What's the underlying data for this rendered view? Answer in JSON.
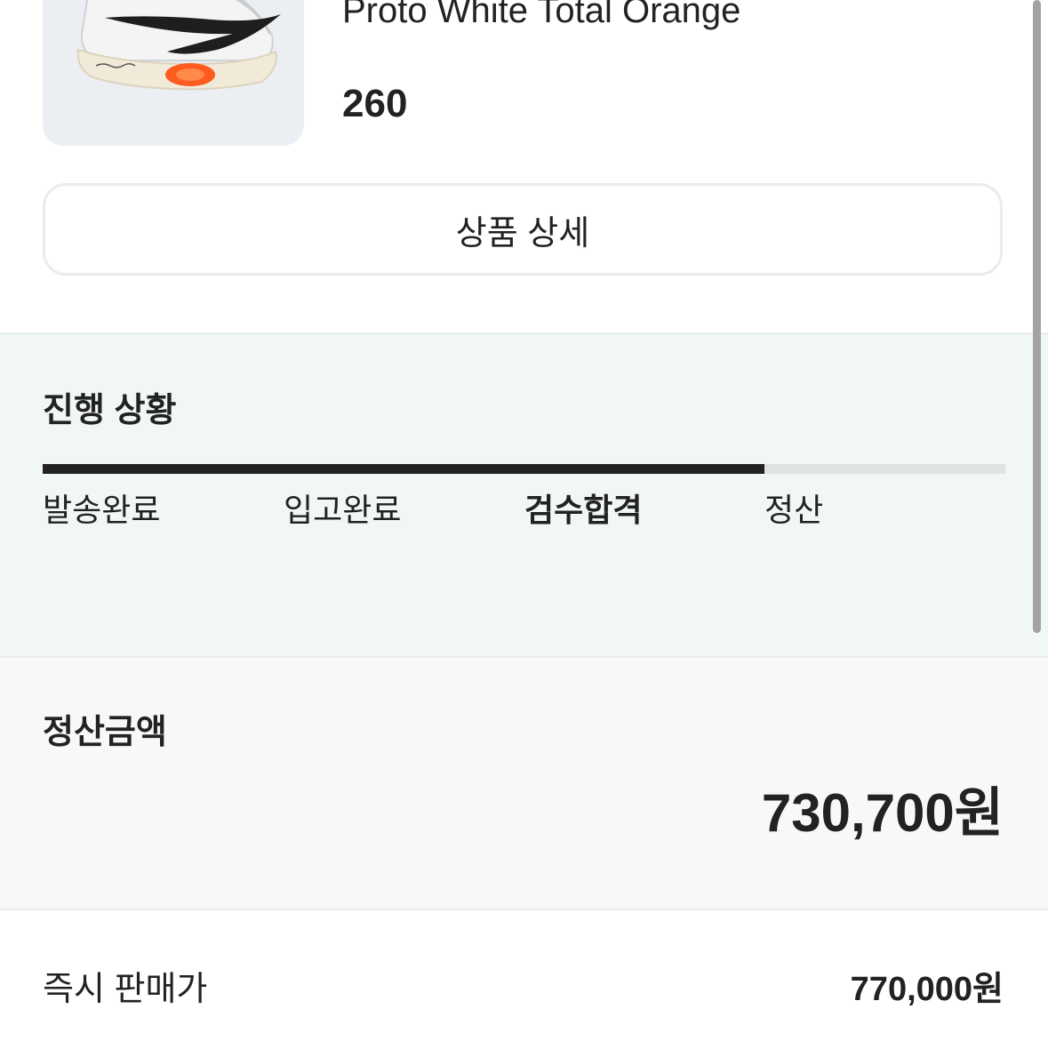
{
  "product": {
    "name": "Proto White Total Orange",
    "size": "260",
    "detail_button_label": "상품 상세"
  },
  "progress": {
    "title": "진행 상황",
    "completed_fraction": 0.75,
    "steps": [
      {
        "label": "발송완료",
        "state": "done"
      },
      {
        "label": "입고완료",
        "state": "done"
      },
      {
        "label": "검수합격",
        "state": "current"
      },
      {
        "label": "정산",
        "state": "pending"
      }
    ]
  },
  "settlement": {
    "title": "정산금액",
    "amount": "730,700원"
  },
  "price_rows": [
    {
      "label": "즉시 판매가",
      "value": "770,000원"
    }
  ],
  "colors": {
    "primary_text": "#222222",
    "progress_bg": "#f1f7f6",
    "settle_bg": "#f8f8f8",
    "thumb_bg": "#ebeef2",
    "shoe_accent": "#ff5a1f"
  }
}
